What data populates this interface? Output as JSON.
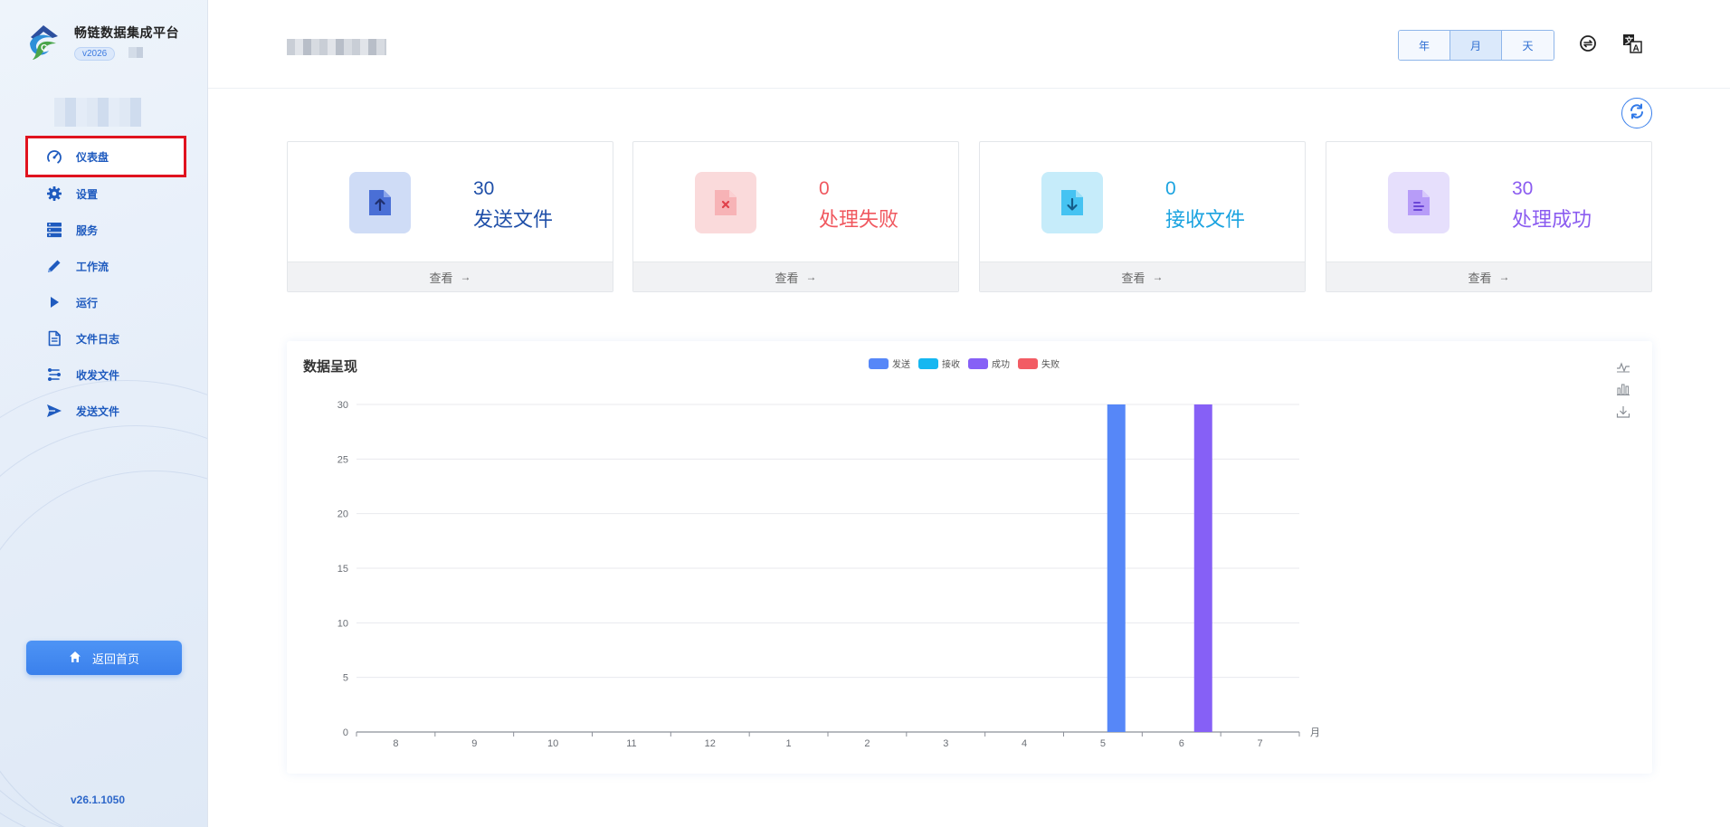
{
  "app": {
    "title": "畅链数据集成平台",
    "version_badge": "v2026",
    "footer_version": "v26.1.1050"
  },
  "sidebar": {
    "items": [
      {
        "label": "仪表盘",
        "icon": "gauge-icon"
      },
      {
        "label": "设置",
        "icon": "gear-icon"
      },
      {
        "label": "服务",
        "icon": "server-icon"
      },
      {
        "label": "工作流",
        "icon": "pencil-icon"
      },
      {
        "label": "运行",
        "icon": "play-icon"
      },
      {
        "label": "文件日志",
        "icon": "file-log-icon"
      },
      {
        "label": "收发文件",
        "icon": "transfer-icon"
      },
      {
        "label": "发送文件",
        "icon": "send-icon"
      }
    ],
    "home_button": "返回首页"
  },
  "header": {
    "period_options": [
      "年",
      "月",
      "天"
    ],
    "selected_period": "月"
  },
  "stats": [
    {
      "value": "30",
      "label": "发送文件",
      "link": "查看",
      "color": "#1f4fa8",
      "icon": "upload-file-icon"
    },
    {
      "value": "0",
      "label": "处理失败",
      "link": "查看",
      "color": "#f0575e",
      "icon": "error-file-icon"
    },
    {
      "value": "0",
      "label": "接收文件",
      "link": "查看",
      "color": "#1aa3e0",
      "icon": "download-file-icon"
    },
    {
      "value": "30",
      "label": "处理成功",
      "link": "查看",
      "color": "#8b5cf0",
      "icon": "success-file-icon"
    }
  ],
  "chart_panel": {
    "title": "数据呈现"
  },
  "chart_data": {
    "type": "bar",
    "title": "数据呈现",
    "categories": [
      "8",
      "9",
      "10",
      "11",
      "12",
      "1",
      "2",
      "3",
      "4",
      "5",
      "6",
      "7"
    ],
    "xlabel": "月",
    "ylabel": "",
    "ylim": [
      0,
      30
    ],
    "yticks": [
      0,
      5,
      10,
      15,
      20,
      25,
      30
    ],
    "legend_position": "top-center",
    "grid": true,
    "series": [
      {
        "name": "发送",
        "color": "#5687f8",
        "values": [
          0,
          0,
          0,
          0,
          0,
          0,
          0,
          0,
          0,
          0,
          30,
          0
        ]
      },
      {
        "name": "接收",
        "color": "#16b7f1",
        "values": [
          0,
          0,
          0,
          0,
          0,
          0,
          0,
          0,
          0,
          0,
          0,
          0
        ]
      },
      {
        "name": "成功",
        "color": "#8660f6",
        "values": [
          0,
          0,
          0,
          0,
          0,
          0,
          0,
          0,
          0,
          0,
          30,
          0
        ]
      },
      {
        "name": "失败",
        "color": "#f25c64",
        "values": [
          0,
          0,
          0,
          0,
          0,
          0,
          0,
          0,
          0,
          0,
          0,
          0
        ]
      }
    ]
  }
}
